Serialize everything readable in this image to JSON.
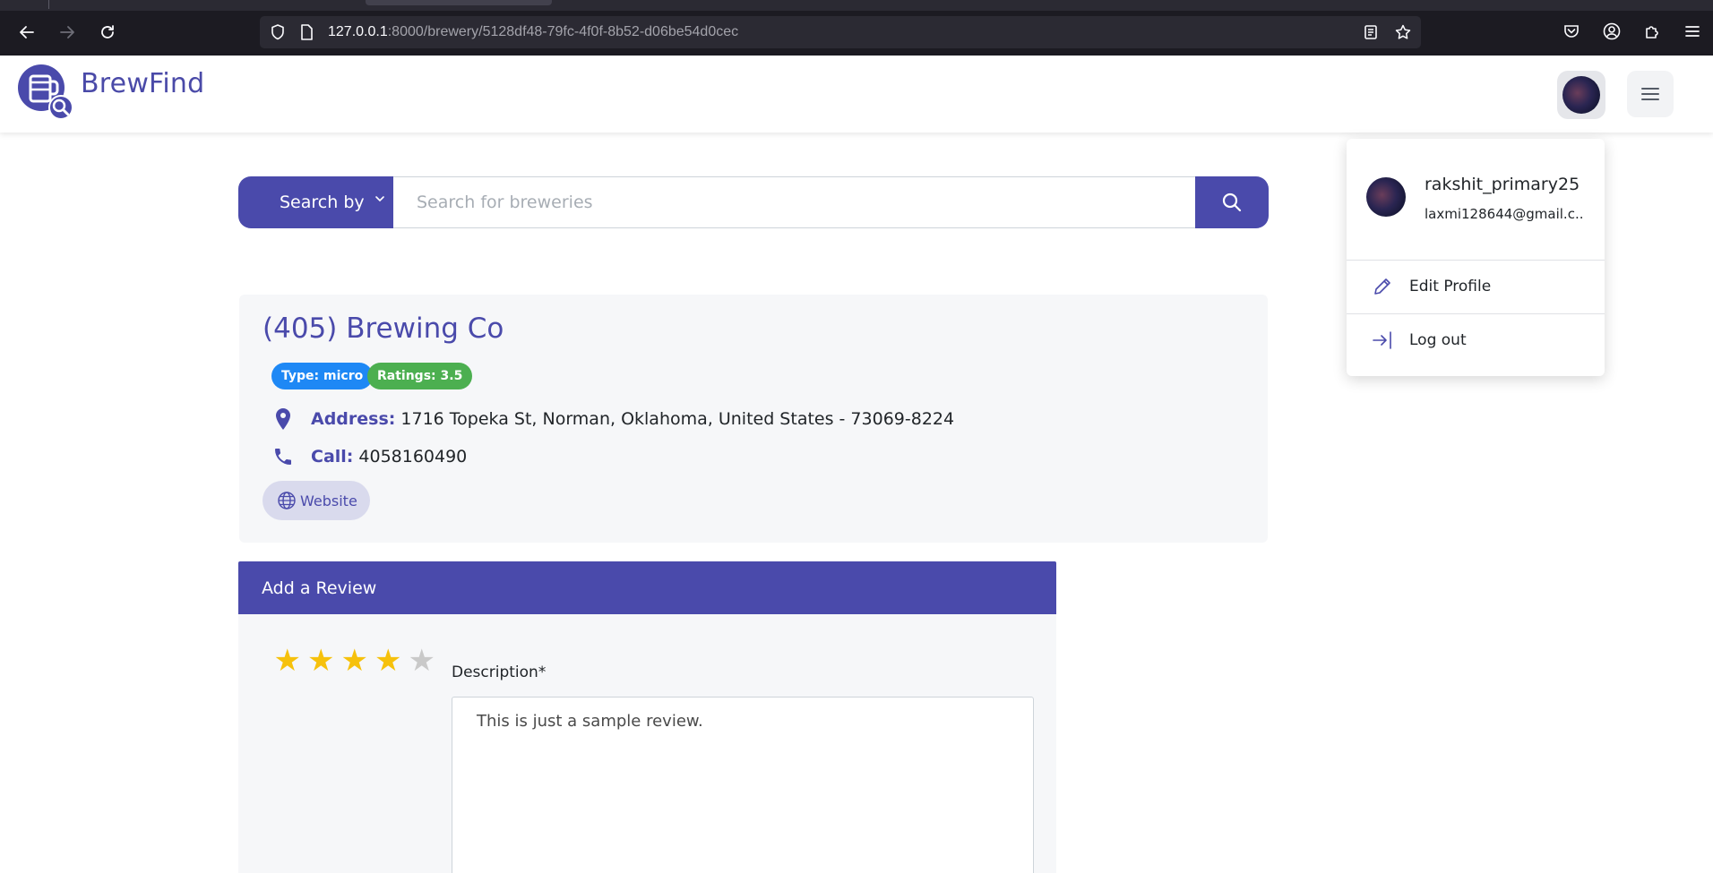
{
  "browser": {
    "url_host": "127.0.0.1",
    "url_path": ":8000/brewery/5128df48-79fc-4f0f-8b52-d06be54d0cec"
  },
  "app": {
    "logo_text": "BrewFind"
  },
  "search": {
    "search_by_label": "Search by",
    "placeholder": "Search for breweries",
    "value": ""
  },
  "brewery": {
    "name": "(405) Brewing Co",
    "type_badge": "Type: micro",
    "rating_badge": "Ratings: 3.5",
    "address_label": "Address:",
    "address_value": "1716 Topeka St, Norman, Oklahoma, United States - 73069-8224",
    "call_label": "Call:",
    "call_value": "4058160490",
    "website_label": "Website"
  },
  "review": {
    "header": "Add a Review",
    "rating": 4,
    "max_rating": 5,
    "description_label": "Description*",
    "description_value": "This is just a sample review."
  },
  "profile_menu": {
    "username": "rakshit_primary25",
    "email": "laxmi128644@gmail.c...",
    "edit_profile": "Edit Profile",
    "log_out": "Log out"
  },
  "colors": {
    "brand": "#4a4aab",
    "type_badge": "#1e88f5",
    "rating_badge": "#4caf50",
    "star_on": "#f6c10c",
    "star_off": "#c9c9c9"
  }
}
